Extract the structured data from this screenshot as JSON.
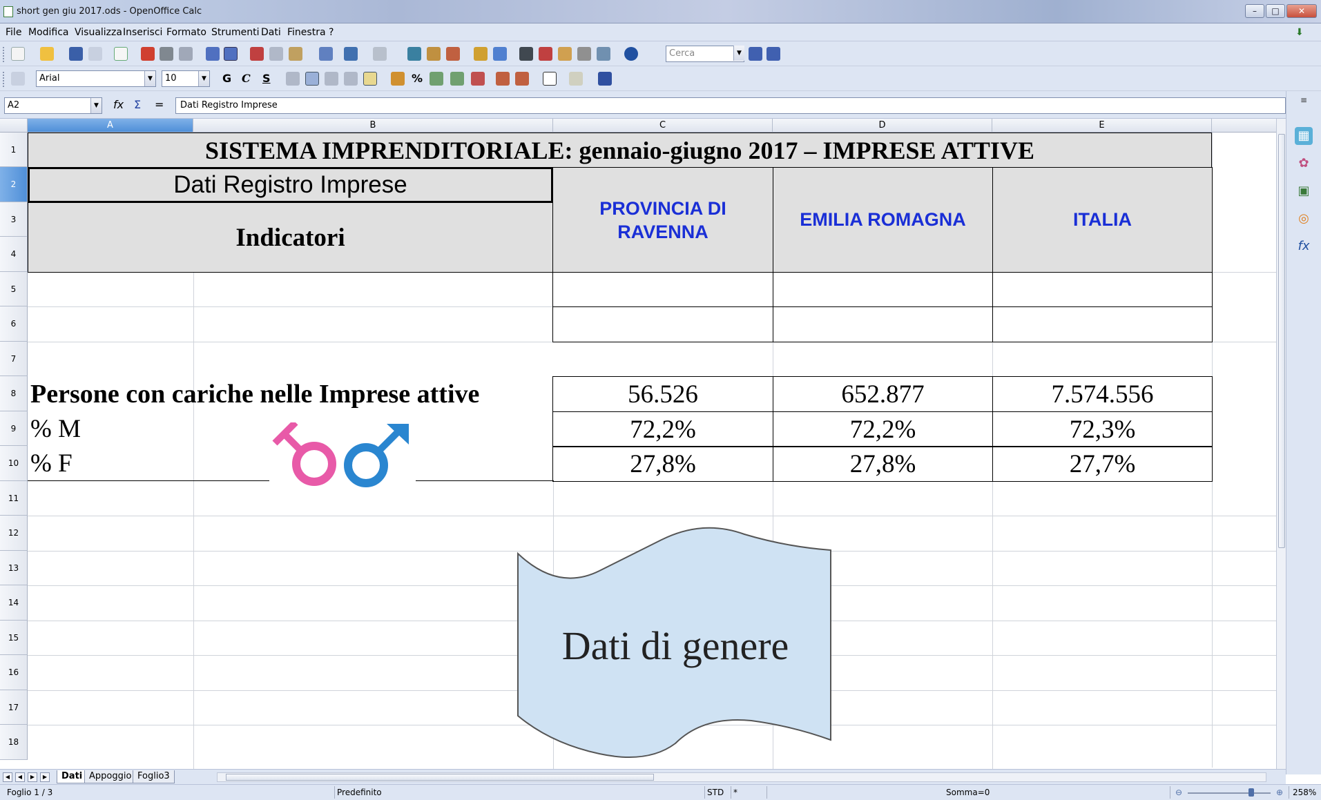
{
  "window": {
    "title": "short gen giu 2017.ods - OpenOffice Calc",
    "minimize": "–",
    "restore": "□",
    "close": "✕"
  },
  "menu": [
    "File",
    "Modifica",
    "Visualizza",
    "Inserisci",
    "Formato",
    "Strumenti",
    "Dati",
    "Finestra",
    "?"
  ],
  "toolbar": {
    "search_placeholder": "Cerca",
    "font_name": "Arial",
    "font_size": "10",
    "bold": "G",
    "italic": "C",
    "underline": "S",
    "percent": "%"
  },
  "formula_bar": {
    "cell_ref": "A2",
    "content": "Dati Registro Imprese",
    "fx_label": "fx",
    "sum_label": "Σ",
    "equals_label": "="
  },
  "columns": [
    "A",
    "B",
    "C",
    "D",
    "E"
  ],
  "selected_column": "A",
  "rows": [
    "1",
    "2",
    "3",
    "4",
    "5",
    "6",
    "7",
    "8",
    "9",
    "10",
    "11",
    "12",
    "13",
    "14",
    "15",
    "16",
    "17",
    "18"
  ],
  "selected_row": "2",
  "sheet": {
    "title": "SISTEMA IMPRENDITORIALE: gennaio-giugno 2017  – IMPRESE  ATTIVE",
    "source": "Dati Registro Imprese",
    "indicators_header": "Indicatori",
    "col_c_header": "PROVINCIA DI RAVENNA",
    "col_d_header": "EMILIA ROMAGNA",
    "col_e_header": "ITALIA",
    "row8": {
      "label": "Persone con cariche nelle Imprese attive",
      "c": "56.526",
      "d": "652.877",
      "e": "7.574.556"
    },
    "row9": {
      "label": "% M",
      "c": "72,2%",
      "d": "72,2%",
      "e": "72,3%"
    },
    "row10": {
      "label": "% F",
      "c": "27,8%",
      "d": "27,8%",
      "e": "27,7%"
    },
    "banner": "Dati di genere"
  },
  "tabs": [
    "Dati",
    "Appoggio",
    "Foglio3"
  ],
  "active_tab": "Dati",
  "status": {
    "sheet": "Foglio 1 / 3",
    "style": "Predefinito",
    "mode": "STD",
    "modified": "*",
    "sum": "Somma=0",
    "zoom": "258%"
  },
  "colors": {
    "header_blue": "#1a2fd6",
    "shade": "#e0e0e0",
    "banner_fill": "#cfe2f3",
    "female_pink": "#e85aa8",
    "male_blue": "#2a86d0"
  }
}
